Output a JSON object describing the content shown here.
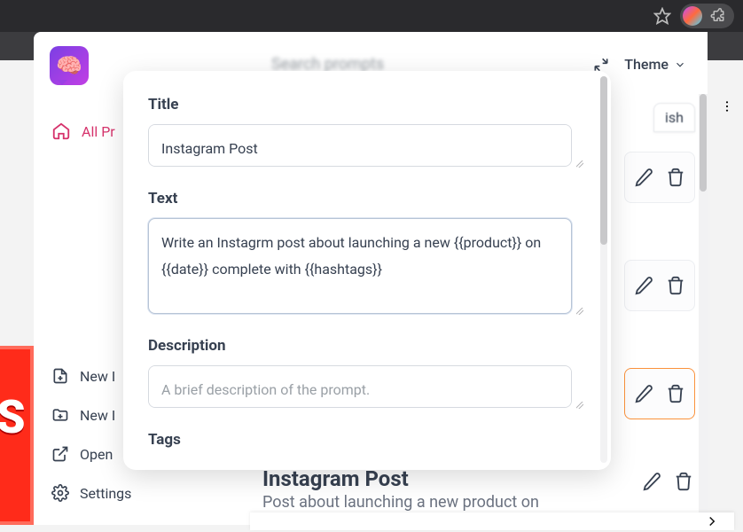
{
  "sidebar": {
    "primary_label": "All Pr",
    "bottom": [
      {
        "label": "New I"
      },
      {
        "label": "New I"
      },
      {
        "label": "Open"
      },
      {
        "label": "Settings"
      }
    ]
  },
  "header": {
    "search_placeholder": "Search prompts",
    "theme_label": "Theme"
  },
  "right_rail": {
    "lang_fragment": "ish"
  },
  "modal": {
    "title_label": "Title",
    "title_value": "Instagram Post",
    "text_label": "Text",
    "text_value": "Write an Instagrm post about launching a new {{product}} on {{date}} complete with {{hashtags}}",
    "description_label": "Description",
    "description_placeholder": "A brief description of the prompt.",
    "tags_label": "Tags"
  },
  "post_card": {
    "title": "Instagram Post",
    "subtitle": "Post about launching a new product on"
  }
}
